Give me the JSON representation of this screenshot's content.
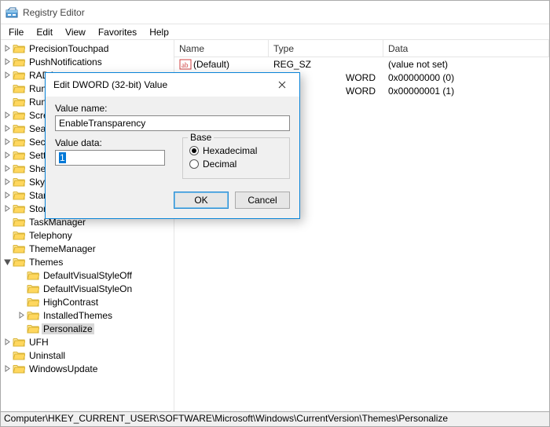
{
  "app": {
    "title": "Registry Editor"
  },
  "menu": {
    "file": "File",
    "edit": "Edit",
    "view": "View",
    "favorites": "Favorites",
    "help": "Help"
  },
  "tree": [
    {
      "label": "PrecisionTouchpad",
      "indent": 1,
      "toggle": "closed"
    },
    {
      "label": "PushNotifications",
      "indent": 1,
      "toggle": "closed"
    },
    {
      "label": "RADA",
      "indent": 1,
      "toggle": "closed",
      "clip": "RADA"
    },
    {
      "label": "Run",
      "indent": 1,
      "toggle": "none",
      "clip": "Run"
    },
    {
      "label": "RunO",
      "indent": 1,
      "toggle": "none",
      "clip": "RunO"
    },
    {
      "label": "Scree",
      "indent": 1,
      "toggle": "closed",
      "clip": "Scree"
    },
    {
      "label": "Searc",
      "indent": 1,
      "toggle": "closed",
      "clip": "Searc"
    },
    {
      "label": "Secu",
      "indent": 1,
      "toggle": "closed",
      "clip": "Secu"
    },
    {
      "label": "Settin",
      "indent": 1,
      "toggle": "closed",
      "clip": "Settin"
    },
    {
      "label": "Shell",
      "indent": 1,
      "toggle": "closed",
      "clip": "Shell"
    },
    {
      "label": "Skyd",
      "indent": 1,
      "toggle": "closed",
      "clip": "Skyd"
    },
    {
      "label": "Startu",
      "indent": 1,
      "toggle": "closed",
      "clip": "Startu"
    },
    {
      "label": "Store",
      "indent": 1,
      "toggle": "closed",
      "clip": "Store"
    },
    {
      "label": "TaskManager",
      "indent": 1,
      "toggle": "none"
    },
    {
      "label": "Telephony",
      "indent": 1,
      "toggle": "none"
    },
    {
      "label": "ThemeManager",
      "indent": 1,
      "toggle": "none"
    },
    {
      "label": "Themes",
      "indent": 1,
      "toggle": "open"
    },
    {
      "label": "DefaultVisualStyleOff",
      "indent": 2,
      "toggle": "none"
    },
    {
      "label": "DefaultVisualStyleOn",
      "indent": 2,
      "toggle": "none"
    },
    {
      "label": "HighContrast",
      "indent": 2,
      "toggle": "none"
    },
    {
      "label": "InstalledThemes",
      "indent": 2,
      "toggle": "closed"
    },
    {
      "label": "Personalize",
      "indent": 2,
      "toggle": "none",
      "selected": true
    },
    {
      "label": "UFH",
      "indent": 1,
      "toggle": "closed"
    },
    {
      "label": "Uninstall",
      "indent": 1,
      "toggle": "none"
    },
    {
      "label": "WindowsUpdate",
      "indent": 1,
      "toggle": "closed"
    }
  ],
  "list": {
    "columns": {
      "name": "Name",
      "type": "Type",
      "data": "Data"
    },
    "rows": [
      {
        "icon": "string",
        "name": "(Default)",
        "type": "REG_SZ",
        "data": "(value not set)"
      },
      {
        "icon": "dword",
        "name": "",
        "type": "WORD",
        "data": "0x00000000 (0)",
        "type_clipped": true
      },
      {
        "icon": "dword",
        "name": "",
        "type": "WORD",
        "data": "0x00000001 (1)",
        "type_clipped": true
      }
    ]
  },
  "statusbar": {
    "path": "Computer\\HKEY_CURRENT_USER\\SOFTWARE\\Microsoft\\Windows\\CurrentVersion\\Themes\\Personalize"
  },
  "dialog": {
    "title": "Edit DWORD (32-bit) Value",
    "valuename_label": "Value name:",
    "valuename": "EnableTransparency",
    "valuedata_label": "Value data:",
    "valuedata": "1",
    "base_label": "Base",
    "hex_label": "Hexadecimal",
    "dec_label": "Decimal",
    "base_selected": "hex",
    "ok": "OK",
    "cancel": "Cancel"
  }
}
